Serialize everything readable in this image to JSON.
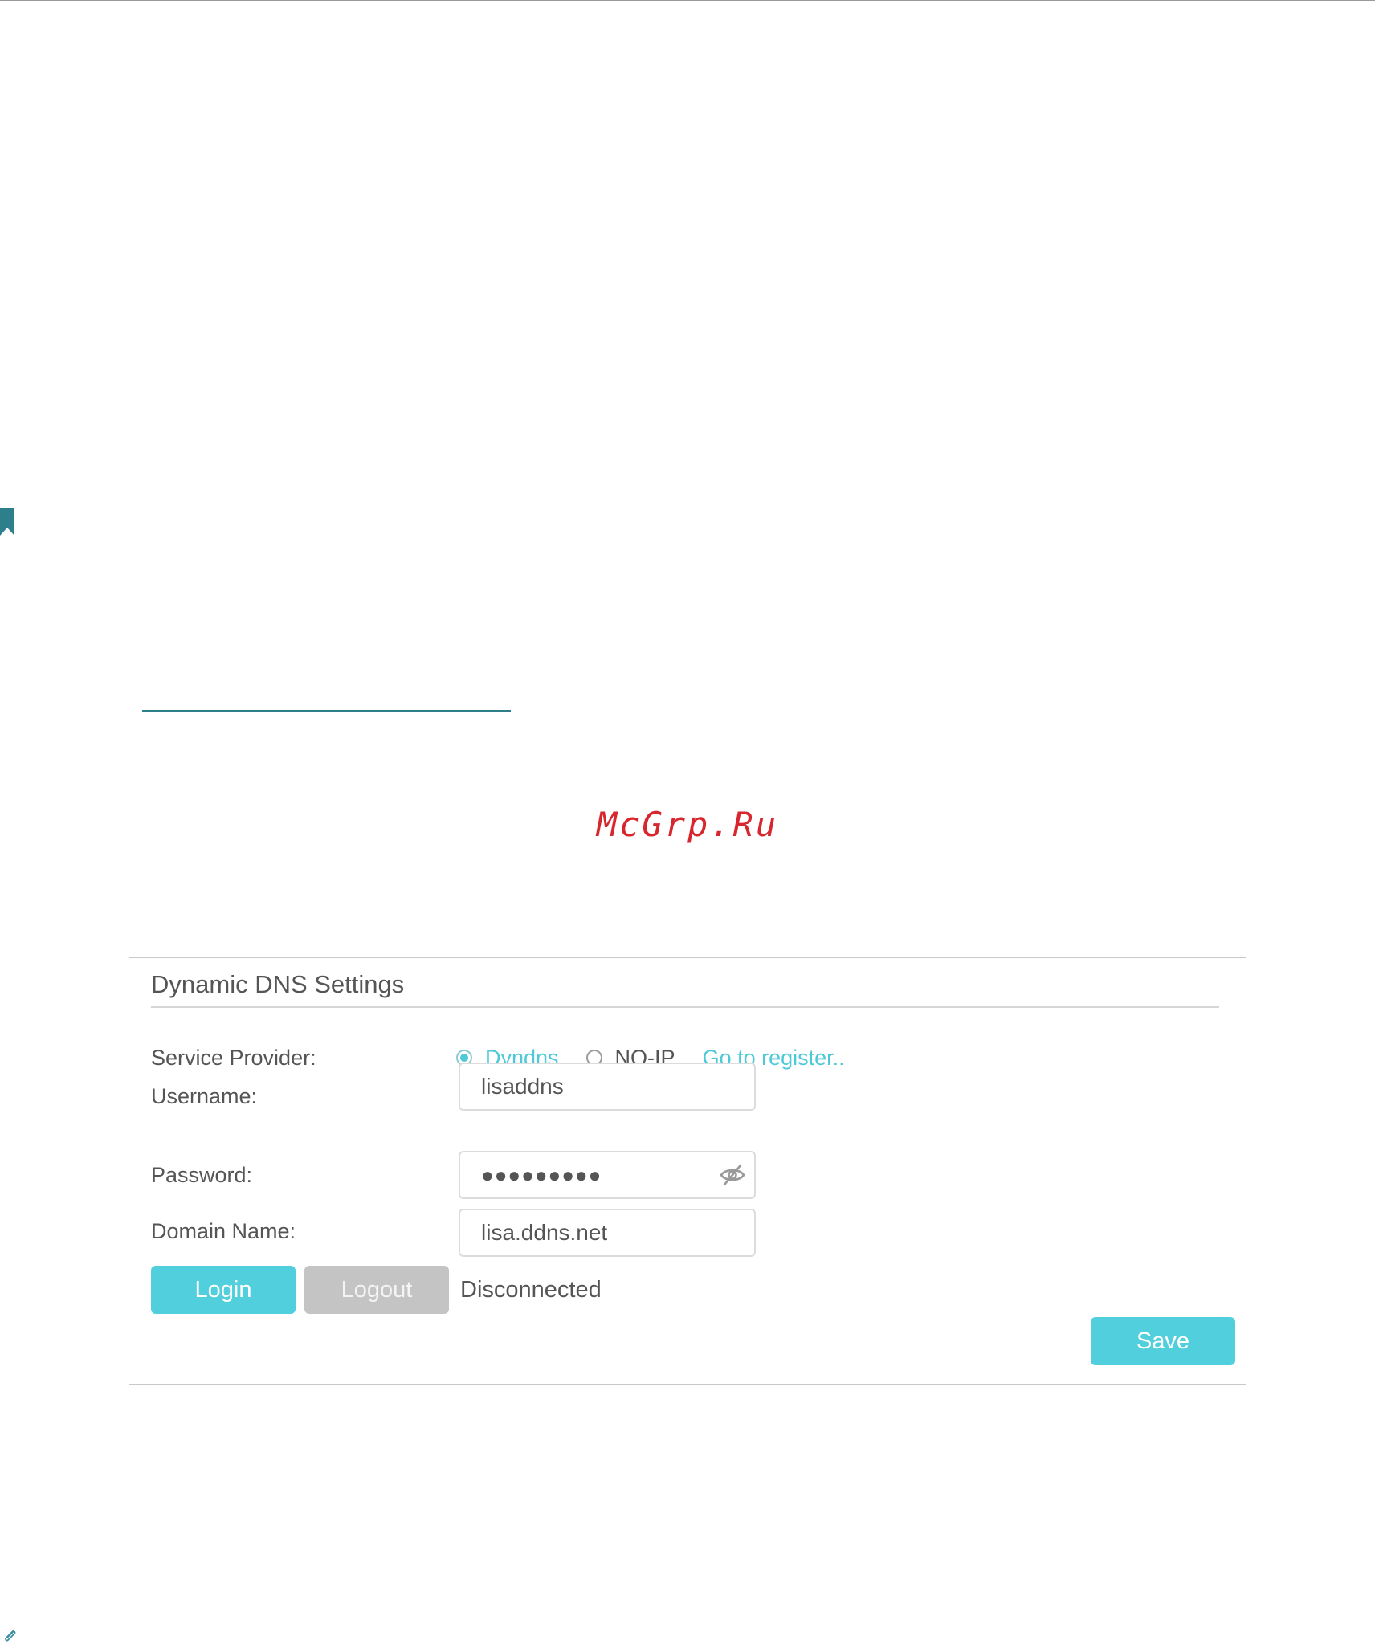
{
  "watermark": "McGrp.Ru",
  "icons": {
    "bookmark": "bookmark-icon",
    "paperclip": "paperclip-icon",
    "eye_hidden": "eye-off-icon"
  },
  "colors": {
    "accent": "#52cfdc",
    "disabled": "#c4c4c4",
    "watermark": "#d8262e",
    "link_rule": "#2f7f8a"
  },
  "ddns": {
    "title": "Dynamic DNS Settings",
    "service_provider": {
      "label": "Service Provider:",
      "options": [
        {
          "label": "Dyndns",
          "selected": true
        },
        {
          "label": "NO-IP",
          "selected": false
        }
      ],
      "register_link": "Go to register.."
    },
    "username": {
      "label": "Username:",
      "value": "lisaddns"
    },
    "password": {
      "label": "Password:",
      "masked_value": "●●●●●●●●●"
    },
    "domain": {
      "label": "Domain Name:",
      "value": "lisa.ddns.net"
    },
    "buttons": {
      "login": "Login",
      "logout": "Logout",
      "save": "Save"
    },
    "status": "Disconnected"
  }
}
